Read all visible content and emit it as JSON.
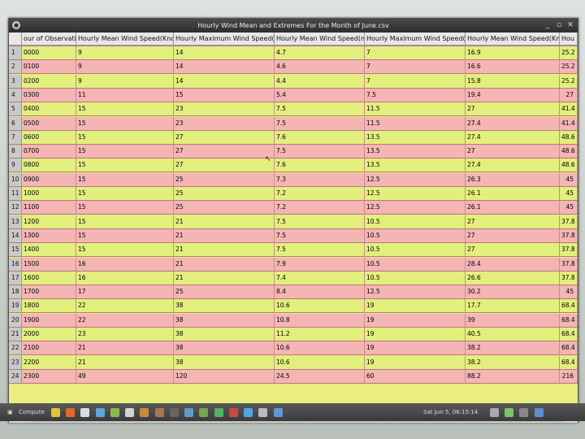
{
  "window": {
    "title": "Hourly Wind Mean and Extremes For the Month of June.csv",
    "controls": {
      "minimize": "_",
      "maximize": "▫",
      "close": "✕"
    }
  },
  "table": {
    "columns": [
      "our of Observati",
      "Hourly Mean Wind Speed(Kno",
      "Hourly Maximum Wind Speed(kn",
      "Hourly Mean Wind Speed(m/s",
      "Hourly Maximum Wind Speed(m",
      "Hourly Mean Wind Speed(Km/",
      "Hou"
    ],
    "rows": [
      [
        "1",
        "0000",
        "9",
        "14",
        "4.7",
        "7",
        "16.9",
        "25.2"
      ],
      [
        "2",
        "0100",
        "9",
        "14",
        "4.6",
        "7",
        "16.6",
        "25.2"
      ],
      [
        "3",
        "0200",
        "9",
        "14",
        "4.4",
        "7",
        "15.8",
        "25.2"
      ],
      [
        "4",
        "0300",
        "11",
        "15",
        "5.4",
        "7.5",
        "19.4",
        "27"
      ],
      [
        "5",
        "0400",
        "15",
        "23",
        "7.5",
        "11.5",
        "27",
        "41.4"
      ],
      [
        "6",
        "0500",
        "15",
        "23",
        "7.5",
        "11.5",
        "27.4",
        "41.4"
      ],
      [
        "7",
        "0600",
        "15",
        "27",
        "7.6",
        "13.5",
        "27.4",
        "48.6"
      ],
      [
        "8",
        "0700",
        "15",
        "27",
        "7.5",
        "13.5",
        "27",
        "48.6"
      ],
      [
        "9",
        "0800",
        "15",
        "27",
        "7.6",
        "13.5",
        "27.4",
        "48.6"
      ],
      [
        "10",
        "0900",
        "15",
        "25",
        "7.3",
        "12.5",
        "26.3",
        "45"
      ],
      [
        "11",
        "1000",
        "15",
        "25",
        "7.2",
        "12.5",
        "26.1",
        "45"
      ],
      [
        "12",
        "1100",
        "15",
        "25",
        "7.2",
        "12.5",
        "26.1",
        "45"
      ],
      [
        "13",
        "1200",
        "15",
        "21",
        "7.5",
        "10.5",
        "27",
        "37.8"
      ],
      [
        "14",
        "1300",
        "15",
        "21",
        "7.5",
        "10.5",
        "27",
        "37.8"
      ],
      [
        "15",
        "1400",
        "15",
        "21",
        "7.5",
        "10.5",
        "27",
        "37.8"
      ],
      [
        "16",
        "1500",
        "16",
        "21",
        "7.9",
        "10.5",
        "28.4",
        "37.8"
      ],
      [
        "17",
        "1600",
        "16",
        "21",
        "7.4",
        "10.5",
        "26.6",
        "37.8"
      ],
      [
        "18",
        "1700",
        "17",
        "25",
        "8.4",
        "12.5",
        "30.2",
        "45"
      ],
      [
        "19",
        "1800",
        "22",
        "38",
        "10.6",
        "19",
        "17.7",
        "68.4"
      ],
      [
        "20",
        "1900",
        "22",
        "38",
        "10.8",
        "19",
        "39",
        "68.4"
      ],
      [
        "21",
        "2000",
        "23",
        "38",
        "11.2",
        "19",
        "40.5",
        "68.4"
      ],
      [
        "22",
        "2100",
        "21",
        "38",
        "10.6",
        "19",
        "38.2",
        "68.4"
      ],
      [
        "23",
        "2200",
        "21",
        "38",
        "10.6",
        "19",
        "38.2",
        "68.4"
      ],
      [
        "24",
        "2300",
        "49",
        "120",
        "24.5",
        "60",
        "88.2",
        "216"
      ]
    ]
  },
  "taskbar": {
    "app_label": "Compute",
    "clock": "Sat Jun 5, 06:15:14"
  },
  "colors": {
    "row_green": "#e3ef7d",
    "row_pink": "#f5b5b5",
    "empty_area": "#e9ee7e"
  }
}
